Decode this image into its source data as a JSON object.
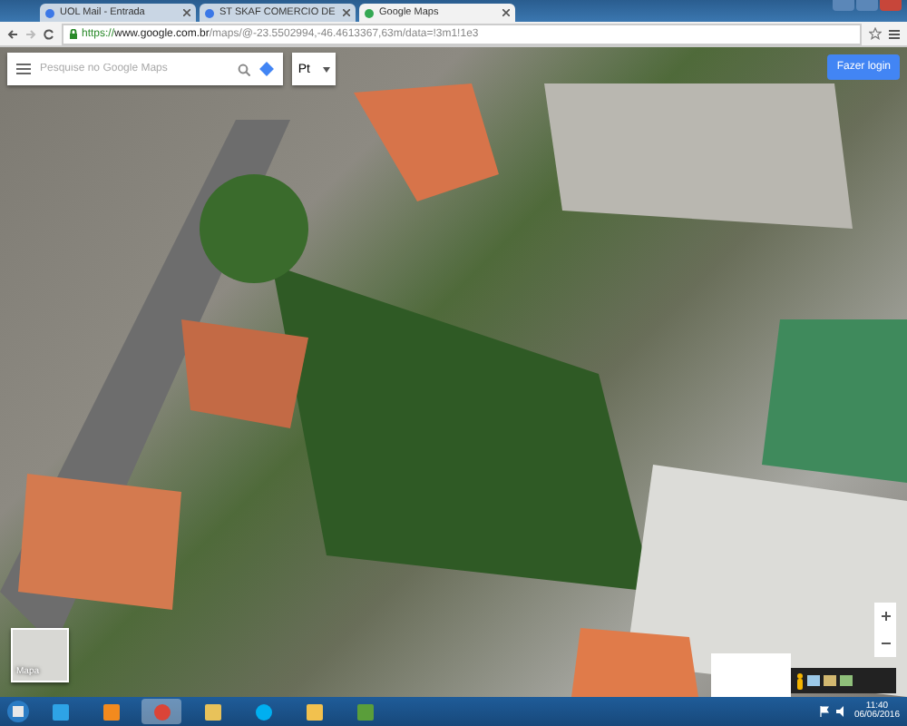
{
  "browser": {
    "tabs": [
      {
        "title": "UOL Mail - Entrada",
        "selected": false
      },
      {
        "title": "ST SKAF COMERCIO DE",
        "selected": false
      },
      {
        "title": "Google Maps",
        "selected": true
      }
    ],
    "url_secure": "https://",
    "url_host": "www.google.com.br",
    "url_path": "/maps/@-23.5502994,-46.4613367,63m/data=!3m1!1e3"
  },
  "map": {
    "search": {
      "placeholder": "Pesquise no Google Maps"
    },
    "language": "Pt",
    "login_button": "Fazer login",
    "map_thumbnail_label": "Mapa"
  },
  "taskbar": {
    "pinned": [
      {
        "kind": "ie"
      },
      {
        "kind": "media"
      },
      {
        "kind": "chrome",
        "selected": true
      },
      {
        "kind": "folder"
      },
      {
        "kind": "skype"
      },
      {
        "kind": "mail"
      },
      {
        "kind": "sheet"
      }
    ],
    "time": "11:40",
    "date": "06/06/2016"
  }
}
